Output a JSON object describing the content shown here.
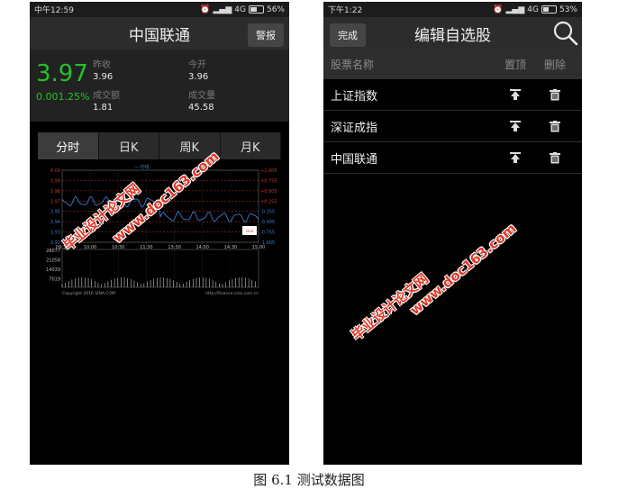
{
  "left": {
    "status": {
      "time": "中午12:59",
      "network": "4G",
      "battery": "56%"
    },
    "title": "中国联通",
    "alert_label": "警报",
    "price": "3.97",
    "change": "0.00",
    "change_pct": "1.25%",
    "fields": {
      "prev_close_label": "昨收",
      "prev_close": "3.96",
      "open_label": "今开",
      "open": "3.96",
      "turnover_label": "成交额",
      "turnover": "1.81",
      "volume_label": "成交量",
      "volume": "45.58"
    },
    "tabs": [
      "分时",
      "日K",
      "周K",
      "月K"
    ],
    "chart": {
      "left_labels": [
        "4.00",
        "3.99",
        "3.98",
        "3.97",
        "3.95",
        "3.94",
        "3.93",
        "3.92"
      ],
      "right_labels": [
        "+1.005",
        "+0.755",
        "+0.505",
        "+0.255",
        "-0.255",
        "-0.505",
        "-0.755",
        "-1.005"
      ],
      "time_labels": [
        "09:30",
        "10:00",
        "10:30",
        "11:30",
        "13:30",
        "14:00",
        "14:30",
        "15:00"
      ],
      "vol_labels": [
        "28077",
        "21058",
        "14039",
        "7019"
      ],
      "legend": "均线",
      "copyright": "Copyright 2016 SINA.COM",
      "source": "http://finance.sina.com.cn",
      "badge": "sina"
    }
  },
  "right": {
    "status": {
      "time": "下午1:22",
      "network": "4G",
      "battery": "53%"
    },
    "done_label": "完成",
    "title": "编辑自选股",
    "columns": {
      "name": "股票名称",
      "pin": "置顶",
      "delete": "删除"
    },
    "stocks": [
      {
        "name": "上证指数"
      },
      {
        "name": "深证成指"
      },
      {
        "name": "中国联通"
      }
    ]
  },
  "watermark": {
    "line1": "毕业设计论文网",
    "line2": "www.doc163.com"
  },
  "caption": "图 6.1 测试数据图",
  "colors": {
    "up": "#24c12c",
    "watermark": "#e13a2a",
    "chart_line": "#3a7bd5",
    "chart_grid": "#c0392b"
  }
}
